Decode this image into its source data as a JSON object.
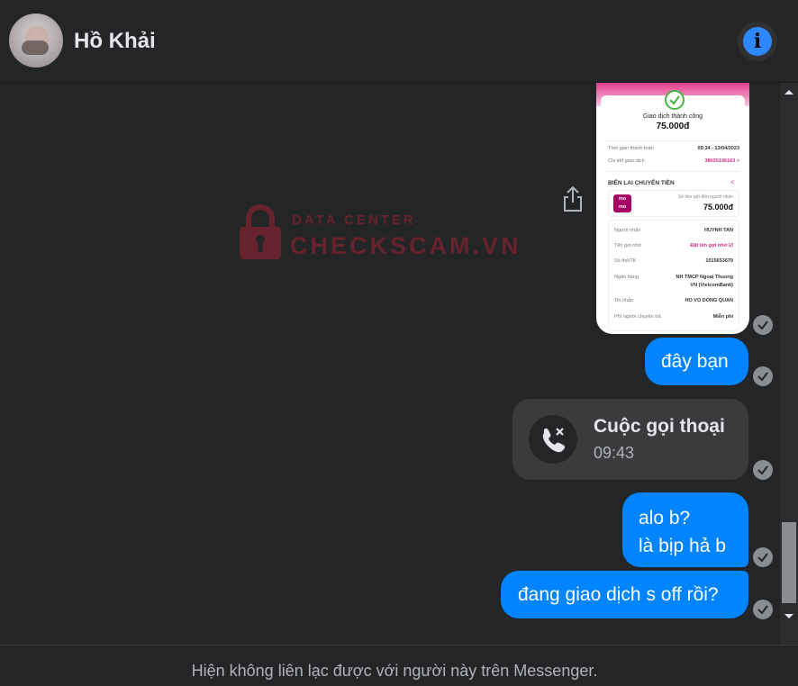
{
  "header": {
    "contact_name": "Hồ Khải"
  },
  "watermark": {
    "line1": "DATA CENTER",
    "line2": "CHECKSCAM.VN"
  },
  "receipt": {
    "status": "Giao dịch thành công",
    "amount": "75.000đ",
    "rows_top": [
      {
        "label": "Thời gian thanh toán",
        "value": "09:34 - 13/04/2023"
      },
      {
        "label": "Chi tiết giao dịch",
        "value": "38035196163 >"
      }
    ],
    "section_title": "BIÊN LAI CHUYỂN TIỀN",
    "momo_logo_top": "mo",
    "momo_logo_bottom": "mo",
    "sent_label": "Số tiền gửi đến người nhận",
    "sent_amount": "75.000đ",
    "details": [
      {
        "label": "Người nhận",
        "value": "HUYNH TAN"
      },
      {
        "label": "Tên gợi nhớ",
        "value": "Đặt tên gợi nhớ ☑"
      },
      {
        "label": "Số thẻ/TK",
        "value": "1015653679"
      },
      {
        "label": "Ngân hàng",
        "value": "NH TMCP Ngoai Thuong"
      },
      {
        "label": "",
        "value": "VN (VietcomBank)"
      },
      {
        "label": "Tin nhắn",
        "value": "HO VO DONG QUAN"
      },
      {
        "label": "Phí người chuyển trả",
        "value": "Miễn phí"
      }
    ]
  },
  "messages": {
    "msg1": "đây bạn",
    "call_title": "Cuộc gọi thoại",
    "call_time": "09:43",
    "msg3_line1": "alo b?",
    "msg3_line2": "là bịp hả b",
    "msg4": "đang giao dịch s off rồi?"
  },
  "footer": {
    "text": "Hiện không liên lạc được với người này trên Messenger."
  },
  "icons": {
    "info": "info-icon",
    "share": "share-icon",
    "call": "missed-call-icon",
    "seen": "check-circle-icon"
  },
  "colors": {
    "background": "#242526",
    "bubble_blue": "#0084ff",
    "call_bubble": "#3a3b3c",
    "info_blue": "#2d88ff",
    "watermark_red": "#e11d3a",
    "momo_pink": "#a50064"
  }
}
